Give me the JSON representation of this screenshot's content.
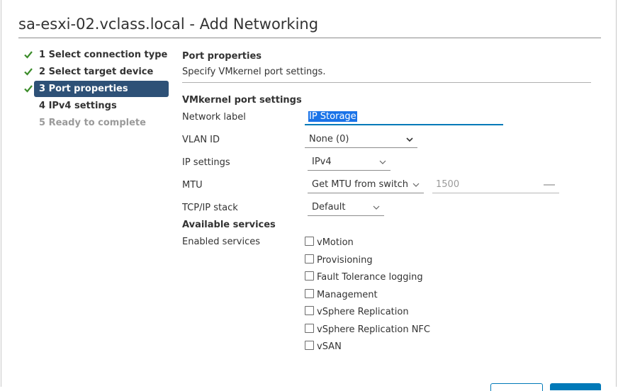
{
  "dialog": {
    "title": "sa-esxi-02.vclass.local - Add Networking"
  },
  "steps": [
    {
      "label": "1 Select connection type",
      "state": "done"
    },
    {
      "label": "2 Select target device",
      "state": "done"
    },
    {
      "label": "3 Port properties",
      "state": "active"
    },
    {
      "label": "4 IPv4 settings",
      "state": "pending"
    },
    {
      "label": "5 Ready to complete",
      "state": "disabled"
    }
  ],
  "page": {
    "title": "Port properties",
    "description": "Specify VMkernel port settings.",
    "settings_title": "VMkernel port settings"
  },
  "form": {
    "network_label": {
      "label": "Network label",
      "value": "IP Storage"
    },
    "vlan_id": {
      "label": "VLAN ID",
      "value": "None (0)"
    },
    "ip_settings": {
      "label": "IP settings",
      "value": "IPv4"
    },
    "mtu": {
      "label": "MTU",
      "mode": "Get MTU from switch",
      "value": "1500"
    },
    "tcpip_stack": {
      "label": "TCP/IP stack",
      "value": "Default"
    }
  },
  "services": {
    "title": "Available services",
    "label": "Enabled services",
    "items": [
      {
        "label": "vMotion",
        "checked": false
      },
      {
        "label": "Provisioning",
        "checked": false
      },
      {
        "label": "Fault Tolerance logging",
        "checked": false
      },
      {
        "label": "Management",
        "checked": false
      },
      {
        "label": "vSphere Replication",
        "checked": false
      },
      {
        "label": "vSphere Replication NFC",
        "checked": false
      },
      {
        "label": "vSAN",
        "checked": false
      }
    ]
  },
  "colors": {
    "accent": "#0079b8",
    "active_step": "#2e5177",
    "check": "#3c8c2a",
    "selection": "#1a73e8"
  }
}
